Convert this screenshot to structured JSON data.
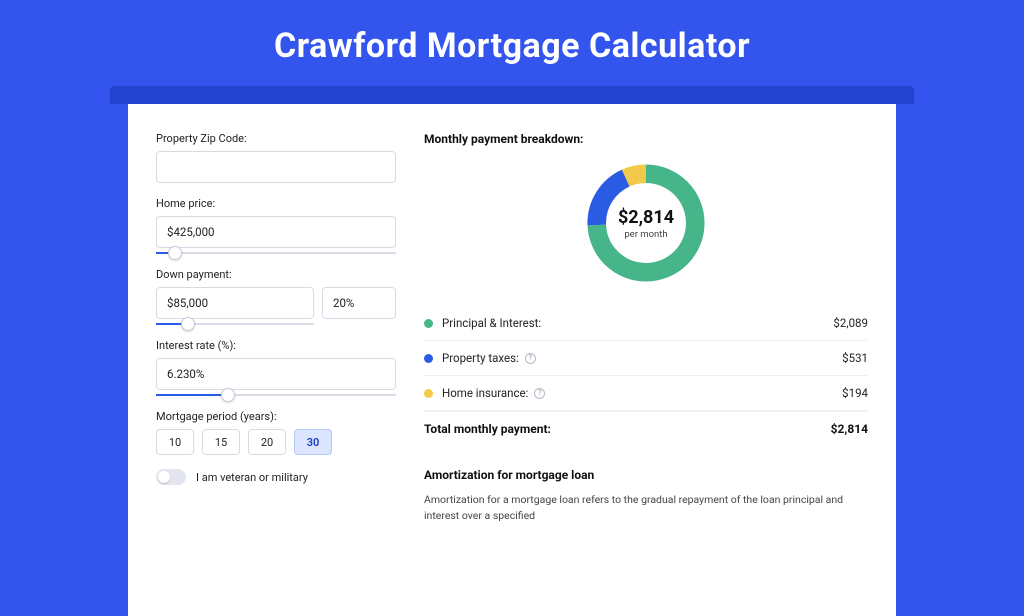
{
  "title": "Crawford Mortgage Calculator",
  "form": {
    "zip": {
      "label": "Property Zip Code:",
      "value": ""
    },
    "price": {
      "label": "Home price:",
      "value": "$425,000",
      "slider_pct": 8
    },
    "down": {
      "label": "Down payment:",
      "value": "$85,000",
      "pct": "20%",
      "slider_pct": 20
    },
    "rate": {
      "label": "Interest rate (%):",
      "value": "6.230%",
      "slider_pct": 30
    },
    "period": {
      "label": "Mortgage period (years):",
      "options": [
        "10",
        "15",
        "20",
        "30"
      ],
      "selected": "30"
    },
    "veteran": {
      "label": "I am veteran or military",
      "on": false
    }
  },
  "breakdown": {
    "heading": "Monthly payment breakdown:",
    "center_value": "$2,814",
    "center_sub": "per month",
    "items": [
      {
        "label": "Principal & Interest:",
        "value": "$2,089",
        "color": "#46b58a",
        "help": false
      },
      {
        "label": "Property taxes:",
        "value": "$531",
        "color": "#2a5be3",
        "help": true
      },
      {
        "label": "Home insurance:",
        "value": "$194",
        "color": "#f1c94b",
        "help": true
      }
    ],
    "total_label": "Total monthly payment:",
    "total_value": "$2,814"
  },
  "chart_data": {
    "type": "pie",
    "title": "Monthly payment breakdown",
    "series": [
      {
        "name": "Principal & Interest",
        "value": 2089,
        "color": "#46b58a"
      },
      {
        "name": "Property taxes",
        "value": 531,
        "color": "#2a5be3"
      },
      {
        "name": "Home insurance",
        "value": 194,
        "color": "#f1c94b"
      }
    ],
    "total": 2814,
    "center_label": "$2,814 per month"
  },
  "amort": {
    "heading": "Amortization for mortgage loan",
    "body": "Amortization for a mortgage loan refers to the gradual repayment of the loan principal and interest over a specified"
  }
}
